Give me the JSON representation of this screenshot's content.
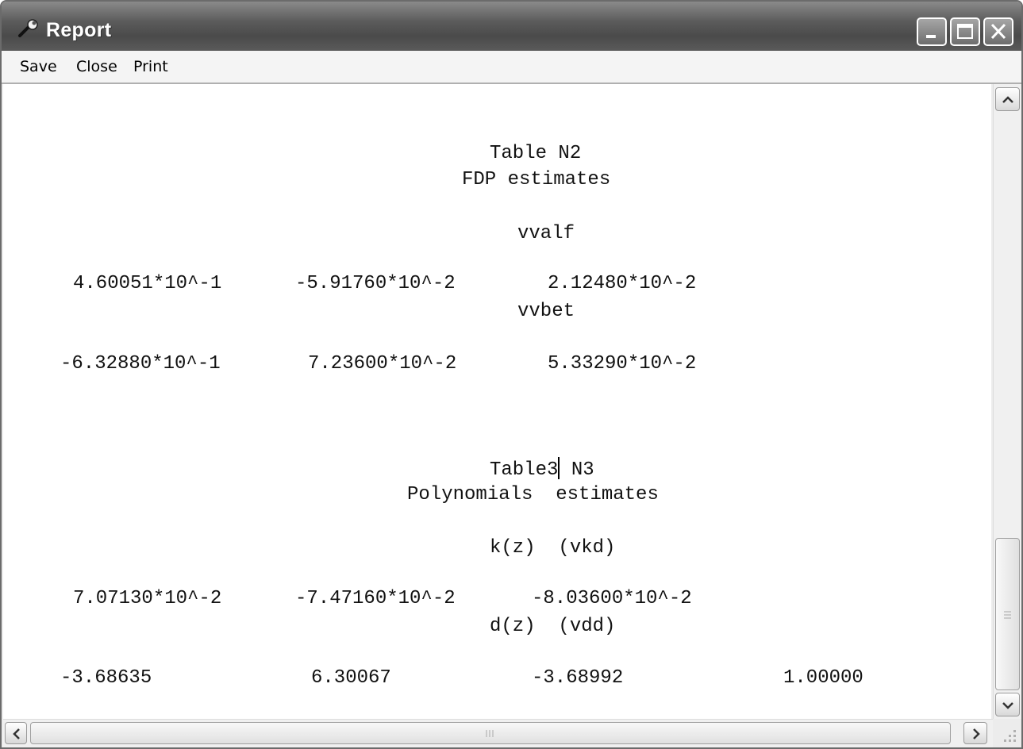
{
  "window": {
    "title": "Report"
  },
  "menu": {
    "save": "Save",
    "close": "Close",
    "print": "Print"
  },
  "report": {
    "table2_title": "Table N2",
    "table2_subtitle": "FDP estimates",
    "vvalf_label": "vvalf",
    "vvalf_values": [
      "4.60051*10^-1",
      "-5.91760*10^-2",
      "2.12480*10^-2"
    ],
    "vvbet_label": "vvbet",
    "vvbet_values": [
      "-6.32880*10^-1",
      "7.23600*10^-2",
      "5.33290*10^-2"
    ],
    "table3_title_before_caret": "Table3",
    "table3_title_after_caret": " N3",
    "table3_subtitle": "Polynomials  estimates",
    "vkd_label": "k(z)  (vkd)",
    "vkd_values": [
      "7.07130*10^-2",
      "-7.47160*10^-2",
      "-8.03600*10^-2"
    ],
    "vdd_label": "d(z)  (vdd)",
    "vdd_values": [
      "-3.68635",
      "6.30067",
      "-3.68992",
      "1.00000"
    ]
  },
  "icons": {
    "app": "wrench-icon",
    "minimize": "minimize-icon",
    "maximize": "maximize-icon",
    "close": "close-icon"
  },
  "colors": {
    "titlebar": "#5c5c5c",
    "content_bg": "#ffffff"
  }
}
